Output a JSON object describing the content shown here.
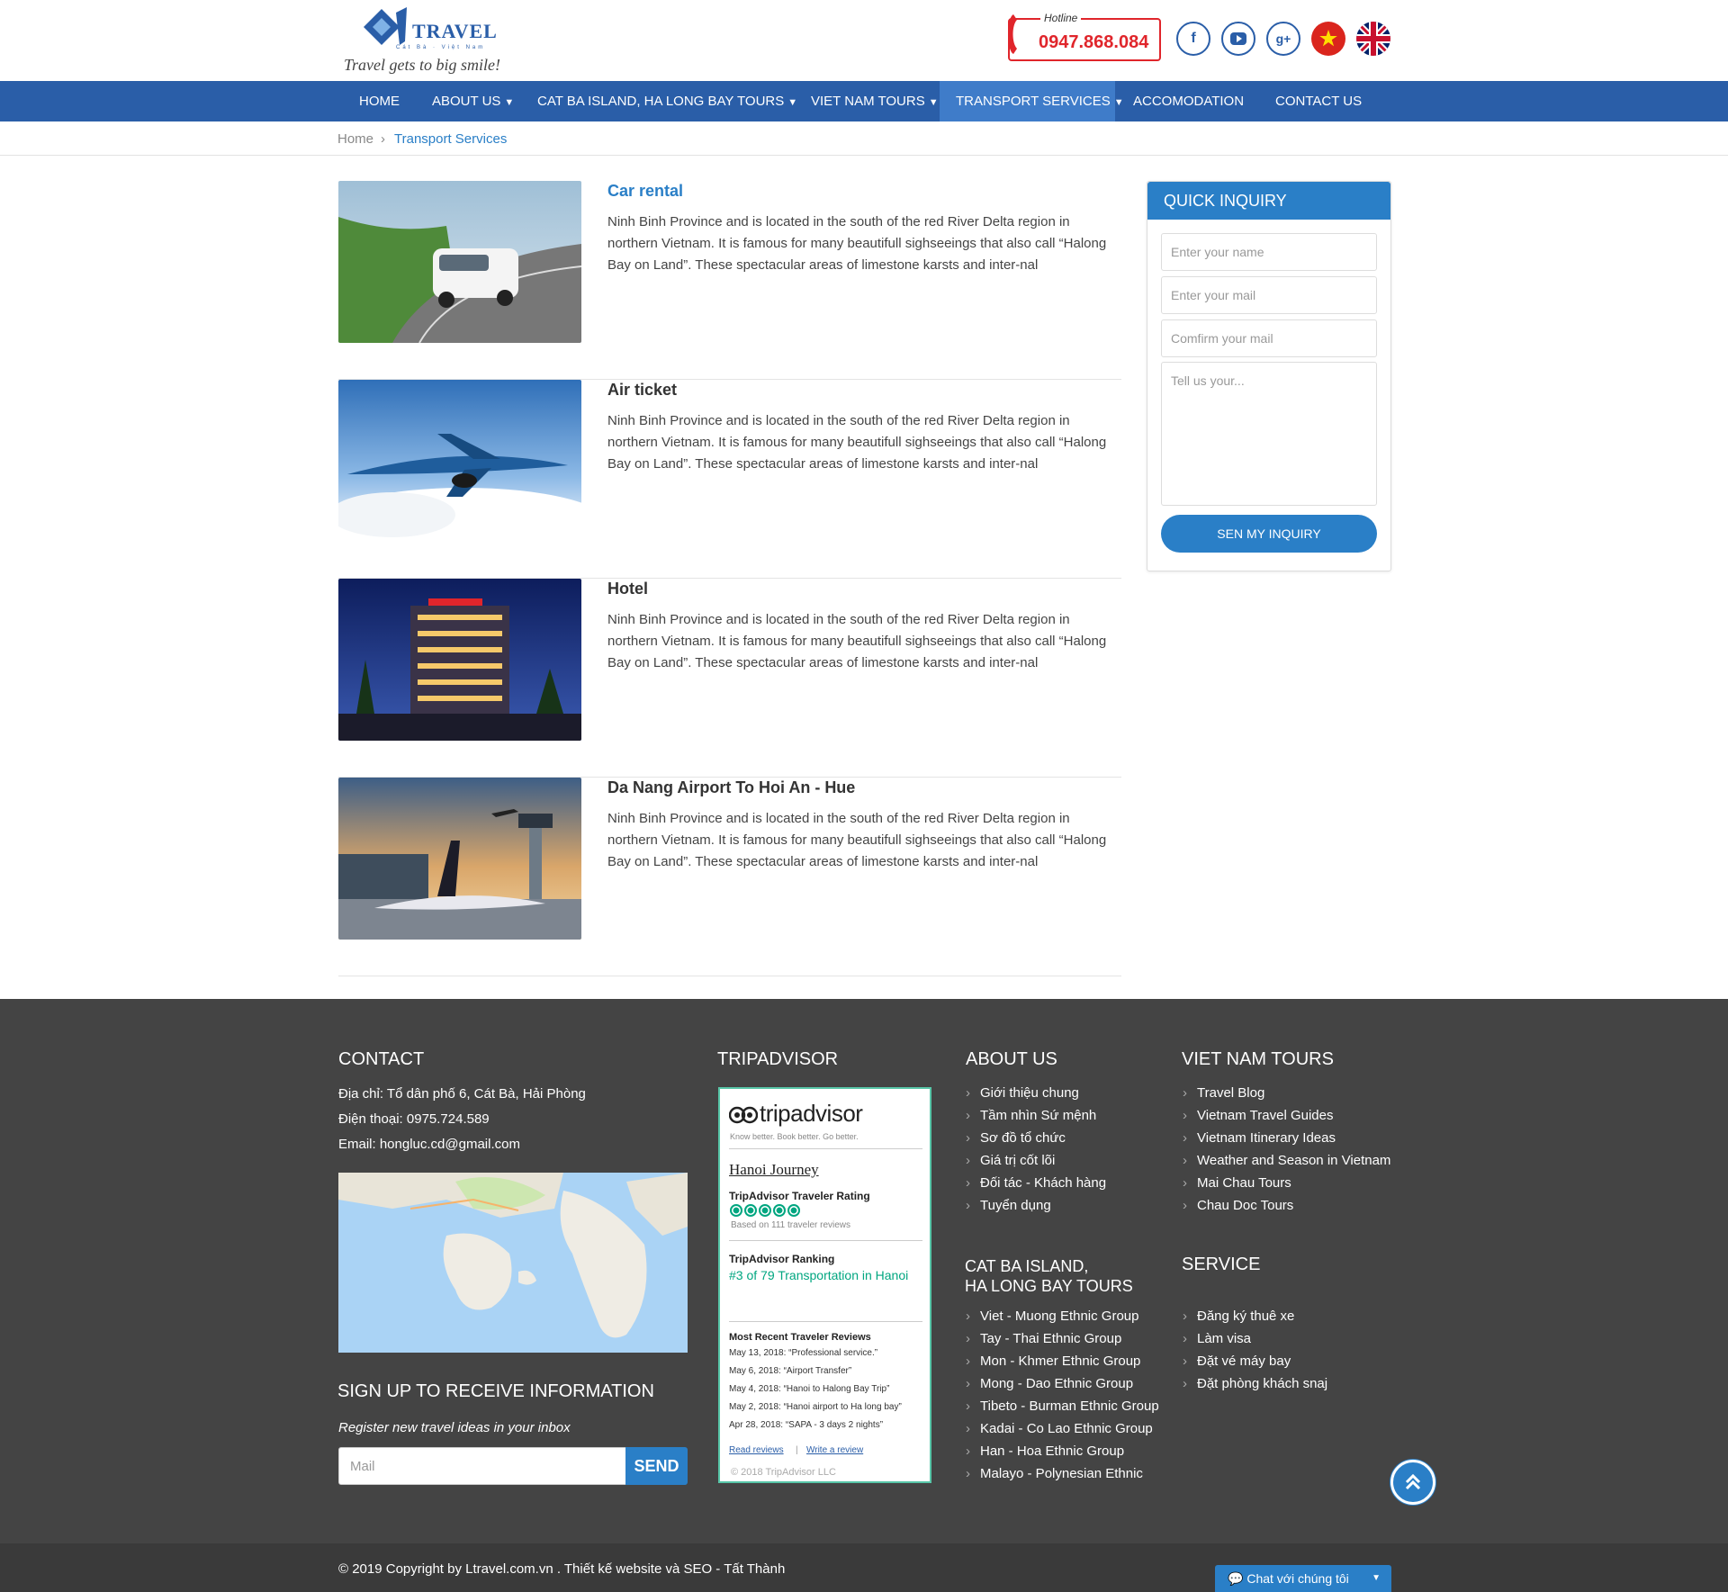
{
  "brand": {
    "name": "TRAVEL",
    "sub": "Cát Bà · Việt Nam",
    "tagline": "Travel gets to big smile!"
  },
  "hotline": {
    "label": "Hotline",
    "number": "0947.868.084"
  },
  "social": {
    "facebook": "f",
    "youtube": "▶",
    "google": "g+"
  },
  "nav": {
    "items": [
      {
        "label": "HOME"
      },
      {
        "label": "ABOUT US"
      },
      {
        "label": "CAT BA ISLAND, HA LONG BAY TOURS"
      },
      {
        "label": "VIET NAM TOURS"
      },
      {
        "label": "TRANSPORT SERVICES"
      },
      {
        "label": "ACCOMODATION"
      },
      {
        "label": "CONTACT US"
      }
    ]
  },
  "breadcrumb": {
    "home": "Home",
    "current": "Transport Services"
  },
  "posts": [
    {
      "title": "Car rental",
      "desc": "Ninh Binh Province and is located in the south of the red River Delta region in northern Vietnam. It is famous for many beautifull sighseeings that also call “Halong Bay on Land”. These spectacular areas of limestone karsts and inter-nal"
    },
    {
      "title": "Air ticket",
      "desc": "Ninh Binh Province and is located in the south of the red River Delta region in northern Vietnam. It is famous for many beautifull sighseeings that also call “Halong Bay on Land”. These spectacular areas of limestone karsts and inter-nal"
    },
    {
      "title": "Hotel",
      "desc": "Ninh Binh Province and is located in the south of the red River Delta region in northern Vietnam. It is famous for many beautifull sighseeings that also call “Halong Bay on Land”. These spectacular areas of limestone karsts and inter-nal"
    },
    {
      "title": "Da Nang Airport To Hoi An - Hue",
      "desc": "Ninh Binh Province and is located in the south of the red River Delta region in northern Vietnam. It is famous for many beautifull sighseeings that also call “Halong Bay on Land”. These spectacular areas of limestone karsts and inter-nal"
    }
  ],
  "inquiry": {
    "title": "QUICK INQUIRY",
    "name_placeholder": "Enter your name",
    "mail_placeholder": "Enter your mail",
    "confirm_placeholder": "Comfirm your mail",
    "message_placeholder": "Tell us your...",
    "button": "SEN MY INQUIRY"
  },
  "footer": {
    "contact": {
      "heading": "CONTACT",
      "address": "Địa chỉ: Tổ dân phố 6, Cát Bà, Hải Phòng",
      "phone": "Điện thoại: 0975.724.589",
      "email": "Email: hongluc.cd@gmail.com"
    },
    "signup": {
      "heading": "SIGN UP TO RECEIVE INFORMATION",
      "note": "Register new travel ideas in your inbox",
      "placeholder": "Mail",
      "button": "SEND"
    },
    "tripadvisor": {
      "heading": "TRIPADVISOR",
      "logo": "tripadvisor",
      "tagline": "Know better. Book better. Go better.",
      "name": "Hanoi Journey",
      "rating_label": "TripAdvisor Traveler Rating",
      "rating_value": 5,
      "based_on": "Based on 111 traveler reviews",
      "ranking_label": "TripAdvisor Ranking",
      "ranking_text": "#3 of 79 Transportation in Hanoi",
      "recent_label": "Most Recent Traveler Reviews",
      "reviews": [
        "May 13, 2018: “Professional service.”",
        "May 6, 2018: “Airport Transfer”",
        "May 4, 2018: “Hanoi to Halong Bay Trip”",
        "May 2, 2018: “Hanoi airport to Ha long bay”",
        "Apr 28, 2018: “SAPA - 3 days 2 nights”"
      ],
      "read_reviews": "Read reviews",
      "write_review": "Write a review",
      "copyright": "© 2018 TripAdvisor LLC"
    },
    "about": {
      "heading": "ABOUT US",
      "items": [
        "Giới thiệu chung",
        "Tầm nhìn Sứ mệnh",
        "Sơ đồ tổ chức",
        "Giá trị cốt lõi",
        "Đối tác - Khách hàng",
        "Tuyển dụng"
      ]
    },
    "catba": {
      "heading_line1": "CAT BA ISLAND,",
      "heading_line2": "HA LONG BAY TOURS",
      "items": [
        "Viet - Muong Ethnic Group",
        "Tay - Thai Ethnic Group",
        "Mon - Khmer Ethnic Group",
        "Mong - Dao Ethnic Group",
        "Tibeto - Burman Ethnic Group",
        "Kadai - Co Lao Ethnic Group",
        "Han - Hoa Ethnic Group",
        "Malayo - Polynesian Ethnic"
      ]
    },
    "vntours": {
      "heading": "VIET NAM TOURS",
      "items": [
        "Travel Blog",
        "Vietnam Travel Guides",
        "Vietnam Itinerary Ideas",
        "Weather and Season in Vietnam",
        "Mai Chau Tours",
        "Chau Doc Tours"
      ]
    },
    "service": {
      "heading": "SERVICE",
      "items": [
        "Đăng ký thuê xe",
        "Làm visa",
        "Đặt vé máy bay",
        "Đặt phòng khách snaj"
      ]
    },
    "copyright": "© 2019 Copyright by Ltravel.com.vn . Thiết kế website và SEO - Tất Thành",
    "chat": "Chat với chúng tôi"
  },
  "colors": {
    "primary": "#2a5ea8",
    "accent": "#2a7fc7",
    "hotline": "#e0252b",
    "footer": "#444444"
  }
}
